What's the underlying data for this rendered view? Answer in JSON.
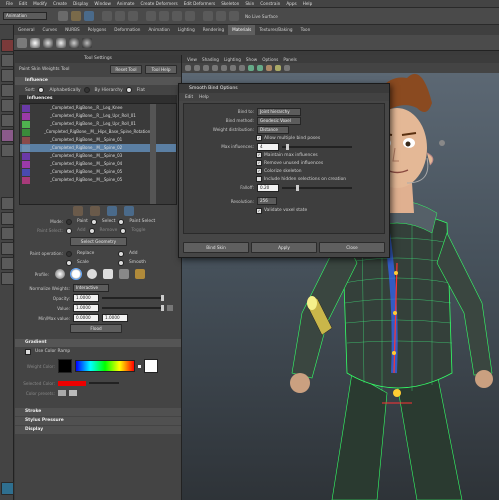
{
  "menubar": [
    "File",
    "Edit",
    "Modify",
    "Create",
    "Display",
    "Window",
    "Animate",
    "Create Deformers",
    "Edit Deformers",
    "Skeleton",
    "Skin",
    "Constrain",
    "Apps",
    "Help"
  ],
  "toolbar": {
    "mode": "Animation",
    "live_surface": "No Live Surface"
  },
  "shelf_tabs": [
    {
      "label": "General",
      "active": false
    },
    {
      "label": "Curves",
      "active": false
    },
    {
      "label": "NURBS",
      "active": false
    },
    {
      "label": "Polygons",
      "active": false
    },
    {
      "label": "Deformation",
      "active": false
    },
    {
      "label": "Animation",
      "active": false
    },
    {
      "label": "Lighting",
      "active": false
    },
    {
      "label": "Rendering",
      "active": false
    },
    {
      "label": "Materials",
      "active": true
    },
    {
      "label": "Textures/Baking",
      "active": false
    },
    {
      "label": "Toon",
      "active": false
    }
  ],
  "tool_settings": {
    "title": "Tool Settings",
    "tool_name": "Paint Skin Weights Tool",
    "reset_button": "Reset Tool",
    "help_button": "Tool Help",
    "influence_header": "Influence",
    "sort_label": "Sort:",
    "sort_options": [
      "Alphabetically",
      "By Hierarchy",
      "Flat"
    ],
    "influences_header": "Influences",
    "influences": [
      {
        "name": "_Completed_RigBone__R__Leg_Knee",
        "color": "#6a3aa8",
        "selected": false
      },
      {
        "name": "_Completed_RigBone__R__Leg_Upr_Roll_01",
        "color": "#9b3aa8",
        "selected": false
      },
      {
        "name": "_Completed_RigBone__R__Leg_Upr_Roll_01",
        "color": "#4fb14f",
        "selected": false
      },
      {
        "name": "_Completed_RigBone__M__Hips_Base_Spine_Rotation",
        "color": "#3a8a3a",
        "selected": false
      },
      {
        "name": "_Completed_RigBone__M__Spine_01",
        "color": "#8a4a4a",
        "selected": false
      },
      {
        "name": "_Completed_RigBone__M__Spine_02",
        "color": "#6e8fb0",
        "selected": true
      },
      {
        "name": "_Completed_RigBone__M__Spine_03",
        "color": "#6a3aa8",
        "selected": false
      },
      {
        "name": "_Completed_RigBone__M__Spine_04",
        "color": "#9b3aa8",
        "selected": false
      },
      {
        "name": "_Completed_RigBone__M__Spine_05",
        "color": "#4a4ab0",
        "selected": false
      },
      {
        "name": "_Completed_RigBone__M__Spine_05",
        "color": "#a83a7a",
        "selected": false
      }
    ],
    "mode_label": "Mode:",
    "mode_options": [
      "Paint",
      "Select",
      "Paint Select"
    ],
    "paint_select_label": "Paint Select:",
    "paint_select_options": [
      "Add",
      "Remove",
      "Toggle"
    ],
    "select_geometry_button": "Select Geometry",
    "paint_operation_label": "Paint operation:",
    "paint_operations": [
      "Replace",
      "Add",
      "Scale",
      "Smooth"
    ],
    "profile_label": "Profile:",
    "normalize_label": "Normalize Weights:",
    "normalize_value": "Interactive",
    "opacity_label": "Opacity:",
    "opacity_value": "1.0000",
    "value_label": "Value:",
    "value_value": "1.0000",
    "minmax_label": "Min/Max value:",
    "min_value": "0.0000",
    "max_value": "1.0000",
    "flood_button": "Flood",
    "gradient_header": "Gradient",
    "use_color_ramp": "Use Color Ramp",
    "weight_color_label": "Weight Color:",
    "selected_color_label": "Selected Color:",
    "color_presets_label": "Color presets:",
    "collapsed_sections": [
      "Stroke",
      "Stylus Pressure",
      "Display"
    ]
  },
  "viewport": {
    "menu": [
      "View",
      "Shading",
      "Lighting",
      "Show",
      "Options",
      "Panels"
    ]
  },
  "dialog": {
    "title": "Smooth Bind Options",
    "menu": [
      "Edit",
      "Help"
    ],
    "bind_to_label": "Bind to:",
    "bind_to_value": "Joint hierarchy",
    "bind_method_label": "Bind method:",
    "bind_method_value": "Geodesic Voxel",
    "weight_distribution_label": "Weight distribution:",
    "weight_distribution_value": "Distance",
    "allow_multiple": "Allow multiple bind poses",
    "max_influences_label": "Max influences:",
    "max_influences_value": "4",
    "maintain_max": "Maintain max influences",
    "remove_unused": "Remove unused influences",
    "colorize": "Colorize skeleton",
    "include_hidden": "Include hidden selections on creation",
    "falloff_label": "Falloff:",
    "falloff_value": "0.20",
    "resolution_label": "Resolution:",
    "resolution_value": "256",
    "validate": "Validate voxel state",
    "bind_skin_button": "Bind Skin",
    "apply_button": "Apply",
    "close_button": "Close"
  }
}
